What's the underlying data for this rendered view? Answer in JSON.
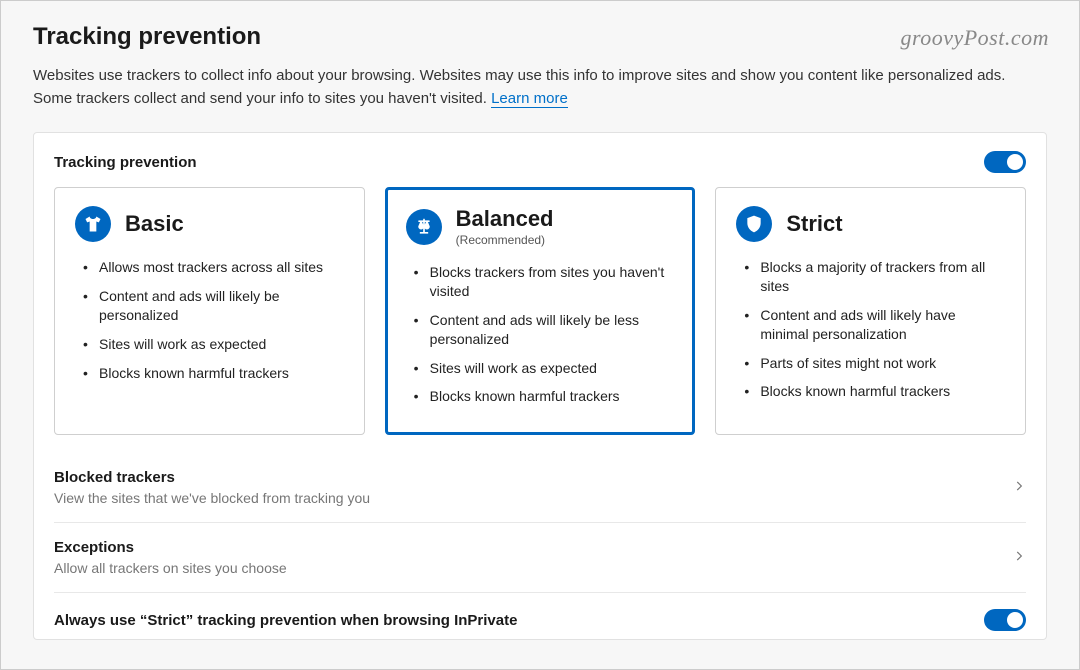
{
  "watermark": "groovyPost.com",
  "header": {
    "title": "Tracking prevention",
    "description_1": "Websites use trackers to collect info about your browsing. Websites may use this info to improve sites and show you content like personalized ads. Some trackers collect and send your info to sites you haven't visited. ",
    "learn_more": "Learn more"
  },
  "card": {
    "title": "Tracking prevention",
    "toggle_on": true
  },
  "levels": [
    {
      "key": "basic",
      "title": "Basic",
      "subtitle": "",
      "selected": false,
      "bullets": [
        "Allows most trackers across all sites",
        "Content and ads will likely be personalized",
        "Sites will work as expected",
        "Blocks known harmful trackers"
      ]
    },
    {
      "key": "balanced",
      "title": "Balanced",
      "subtitle": "(Recommended)",
      "selected": true,
      "bullets": [
        "Blocks trackers from sites you haven't visited",
        "Content and ads will likely be less personalized",
        "Sites will work as expected",
        "Blocks known harmful trackers"
      ]
    },
    {
      "key": "strict",
      "title": "Strict",
      "subtitle": "",
      "selected": false,
      "bullets": [
        "Blocks a majority of trackers from all sites",
        "Content and ads will likely have minimal personalization",
        "Parts of sites might not work",
        "Blocks known harmful trackers"
      ]
    }
  ],
  "rows": {
    "blocked": {
      "title": "Blocked trackers",
      "desc": "View the sites that we've blocked from tracking you"
    },
    "exceptions": {
      "title": "Exceptions",
      "desc": "Allow all trackers on sites you choose"
    },
    "always_strict": {
      "title": "Always use “Strict” tracking prevention when browsing InPrivate",
      "toggle_on": true
    }
  },
  "colors": {
    "accent": "#0067c0",
    "link": "#0070c9"
  }
}
